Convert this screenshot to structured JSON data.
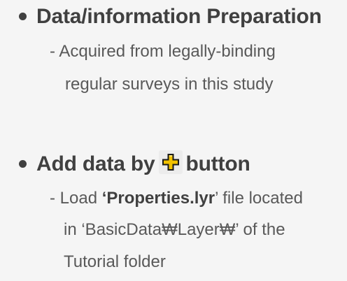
{
  "section1": {
    "heading": "Data/information Preparation",
    "sub_line1": "- Acquired from legally-binding",
    "sub_line2": "regular surveys in this study"
  },
  "section2": {
    "heading_prefix": "Add data by",
    "heading_icon": "add-data-plus-icon",
    "heading_suffix": "button",
    "sub_line1_pre": "- Load ",
    "sub_line1_bold": "‘Properties.lyr",
    "sub_line1_post": "’ file located",
    "sub_line2": "in ‘BasicData₩Layer₩’ of the",
    "sub_line3": "Tutorial folder"
  },
  "colors": {
    "background": "#f5f5f5",
    "heading_text": "#404040",
    "body_text": "#595959",
    "icon_fill": "#f2c200",
    "icon_outline": "#1a1a1a"
  }
}
